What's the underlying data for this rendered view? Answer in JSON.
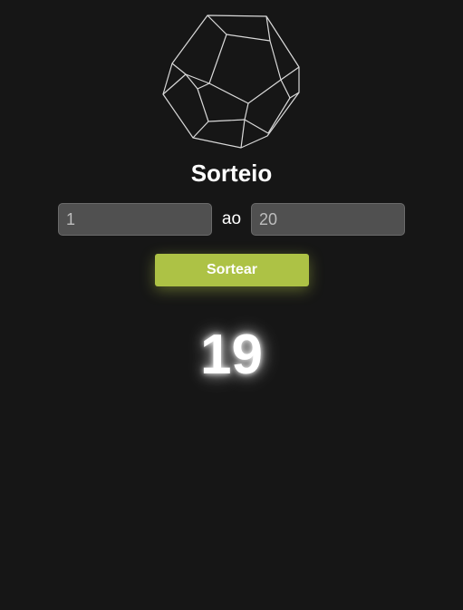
{
  "title": "Sorteio",
  "range": {
    "min_value": "1",
    "separator": "ao",
    "max_value": "20"
  },
  "draw_button_label": "Sortear",
  "result": "19",
  "colors": {
    "background": "#161616",
    "accent": "#adc245",
    "input_background": "#505050"
  },
  "logo_icon": "dodecahedron-icon"
}
